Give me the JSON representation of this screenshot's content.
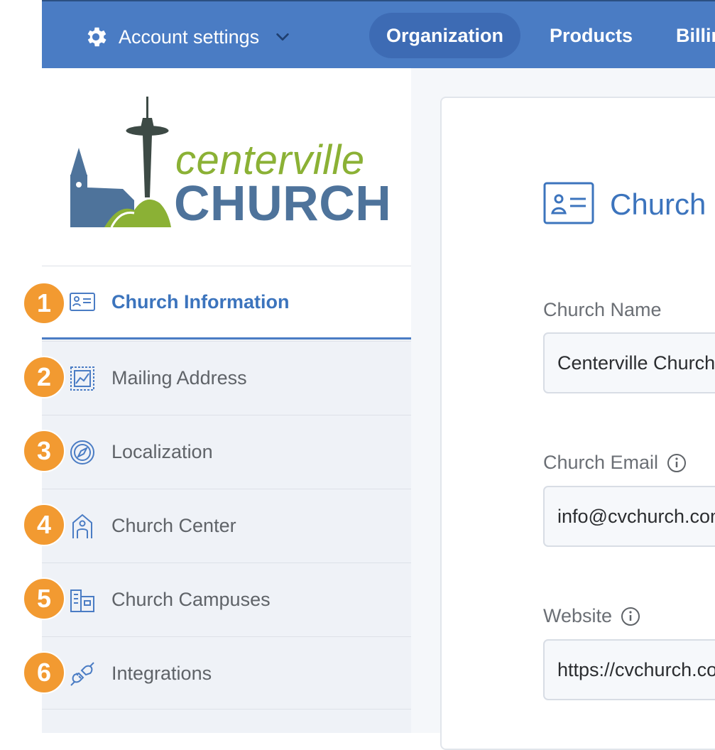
{
  "topbar": {
    "account_label": "Account settings",
    "tabs": [
      {
        "label": "Organization",
        "active": true
      },
      {
        "label": "Products",
        "active": false
      },
      {
        "label": "Billing",
        "active": false
      }
    ],
    "bg_color": "#4a7cc4"
  },
  "logo": {
    "line1": "centerville",
    "line2": "CHURCH"
  },
  "sidebar": {
    "items": [
      {
        "number": "1",
        "label": "Church Information",
        "icon": "id-card-icon",
        "active": true
      },
      {
        "number": "2",
        "label": "Mailing Address",
        "icon": "stamp-icon",
        "active": false
      },
      {
        "number": "3",
        "label": "Localization",
        "icon": "compass-icon",
        "active": false
      },
      {
        "number": "4",
        "label": "Church Center",
        "icon": "church-center-icon",
        "active": false
      },
      {
        "number": "5",
        "label": "Church Campuses",
        "icon": "campus-buildings-icon",
        "active": false
      },
      {
        "number": "6",
        "label": "Integrations",
        "icon": "plug-icon",
        "active": false
      }
    ]
  },
  "main": {
    "title": "Church Information",
    "fields": [
      {
        "label": "Church Name",
        "value": "Centerville Church",
        "info": false
      },
      {
        "label": "Church Email",
        "value": "info@cvchurch.com",
        "info": true
      },
      {
        "label": "Website",
        "value": "https://cvchurch.com",
        "info": true
      }
    ]
  },
  "colors": {
    "accent": "#3c74bd",
    "badge": "#f29a31",
    "logo_green": "#8bb135",
    "logo_blue": "#4e739b"
  }
}
